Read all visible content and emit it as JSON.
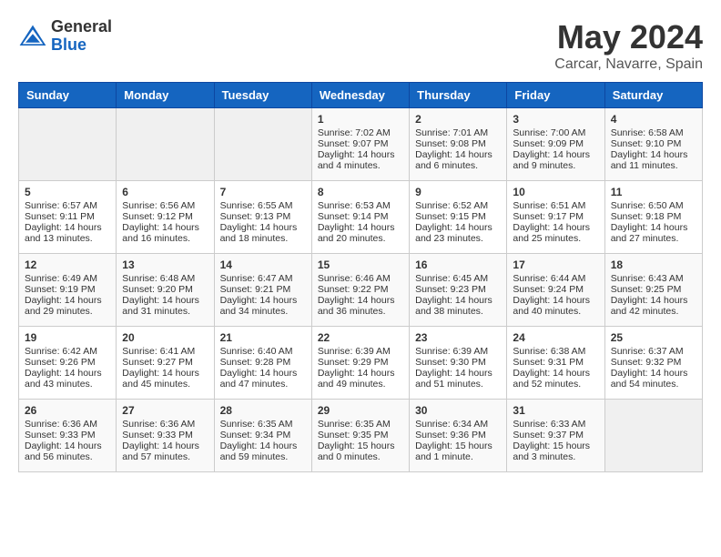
{
  "header": {
    "logo_general": "General",
    "logo_blue": "Blue",
    "month_year": "May 2024",
    "location": "Carcar, Navarre, Spain"
  },
  "calendar": {
    "days_of_week": [
      "Sunday",
      "Monday",
      "Tuesday",
      "Wednesday",
      "Thursday",
      "Friday",
      "Saturday"
    ],
    "weeks": [
      [
        {
          "day": "",
          "sunrise": "",
          "sunset": "",
          "daylight": ""
        },
        {
          "day": "",
          "sunrise": "",
          "sunset": "",
          "daylight": ""
        },
        {
          "day": "",
          "sunrise": "",
          "sunset": "",
          "daylight": ""
        },
        {
          "day": "1",
          "sunrise": "Sunrise: 7:02 AM",
          "sunset": "Sunset: 9:07 PM",
          "daylight": "Daylight: 14 hours and 4 minutes."
        },
        {
          "day": "2",
          "sunrise": "Sunrise: 7:01 AM",
          "sunset": "Sunset: 9:08 PM",
          "daylight": "Daylight: 14 hours and 6 minutes."
        },
        {
          "day": "3",
          "sunrise": "Sunrise: 7:00 AM",
          "sunset": "Sunset: 9:09 PM",
          "daylight": "Daylight: 14 hours and 9 minutes."
        },
        {
          "day": "4",
          "sunrise": "Sunrise: 6:58 AM",
          "sunset": "Sunset: 9:10 PM",
          "daylight": "Daylight: 14 hours and 11 minutes."
        }
      ],
      [
        {
          "day": "5",
          "sunrise": "Sunrise: 6:57 AM",
          "sunset": "Sunset: 9:11 PM",
          "daylight": "Daylight: 14 hours and 13 minutes."
        },
        {
          "day": "6",
          "sunrise": "Sunrise: 6:56 AM",
          "sunset": "Sunset: 9:12 PM",
          "daylight": "Daylight: 14 hours and 16 minutes."
        },
        {
          "day": "7",
          "sunrise": "Sunrise: 6:55 AM",
          "sunset": "Sunset: 9:13 PM",
          "daylight": "Daylight: 14 hours and 18 minutes."
        },
        {
          "day": "8",
          "sunrise": "Sunrise: 6:53 AM",
          "sunset": "Sunset: 9:14 PM",
          "daylight": "Daylight: 14 hours and 20 minutes."
        },
        {
          "day": "9",
          "sunrise": "Sunrise: 6:52 AM",
          "sunset": "Sunset: 9:15 PM",
          "daylight": "Daylight: 14 hours and 23 minutes."
        },
        {
          "day": "10",
          "sunrise": "Sunrise: 6:51 AM",
          "sunset": "Sunset: 9:17 PM",
          "daylight": "Daylight: 14 hours and 25 minutes."
        },
        {
          "day": "11",
          "sunrise": "Sunrise: 6:50 AM",
          "sunset": "Sunset: 9:18 PM",
          "daylight": "Daylight: 14 hours and 27 minutes."
        }
      ],
      [
        {
          "day": "12",
          "sunrise": "Sunrise: 6:49 AM",
          "sunset": "Sunset: 9:19 PM",
          "daylight": "Daylight: 14 hours and 29 minutes."
        },
        {
          "day": "13",
          "sunrise": "Sunrise: 6:48 AM",
          "sunset": "Sunset: 9:20 PM",
          "daylight": "Daylight: 14 hours and 31 minutes."
        },
        {
          "day": "14",
          "sunrise": "Sunrise: 6:47 AM",
          "sunset": "Sunset: 9:21 PM",
          "daylight": "Daylight: 14 hours and 34 minutes."
        },
        {
          "day": "15",
          "sunrise": "Sunrise: 6:46 AM",
          "sunset": "Sunset: 9:22 PM",
          "daylight": "Daylight: 14 hours and 36 minutes."
        },
        {
          "day": "16",
          "sunrise": "Sunrise: 6:45 AM",
          "sunset": "Sunset: 9:23 PM",
          "daylight": "Daylight: 14 hours and 38 minutes."
        },
        {
          "day": "17",
          "sunrise": "Sunrise: 6:44 AM",
          "sunset": "Sunset: 9:24 PM",
          "daylight": "Daylight: 14 hours and 40 minutes."
        },
        {
          "day": "18",
          "sunrise": "Sunrise: 6:43 AM",
          "sunset": "Sunset: 9:25 PM",
          "daylight": "Daylight: 14 hours and 42 minutes."
        }
      ],
      [
        {
          "day": "19",
          "sunrise": "Sunrise: 6:42 AM",
          "sunset": "Sunset: 9:26 PM",
          "daylight": "Daylight: 14 hours and 43 minutes."
        },
        {
          "day": "20",
          "sunrise": "Sunrise: 6:41 AM",
          "sunset": "Sunset: 9:27 PM",
          "daylight": "Daylight: 14 hours and 45 minutes."
        },
        {
          "day": "21",
          "sunrise": "Sunrise: 6:40 AM",
          "sunset": "Sunset: 9:28 PM",
          "daylight": "Daylight: 14 hours and 47 minutes."
        },
        {
          "day": "22",
          "sunrise": "Sunrise: 6:39 AM",
          "sunset": "Sunset: 9:29 PM",
          "daylight": "Daylight: 14 hours and 49 minutes."
        },
        {
          "day": "23",
          "sunrise": "Sunrise: 6:39 AM",
          "sunset": "Sunset: 9:30 PM",
          "daylight": "Daylight: 14 hours and 51 minutes."
        },
        {
          "day": "24",
          "sunrise": "Sunrise: 6:38 AM",
          "sunset": "Sunset: 9:31 PM",
          "daylight": "Daylight: 14 hours and 52 minutes."
        },
        {
          "day": "25",
          "sunrise": "Sunrise: 6:37 AM",
          "sunset": "Sunset: 9:32 PM",
          "daylight": "Daylight: 14 hours and 54 minutes."
        }
      ],
      [
        {
          "day": "26",
          "sunrise": "Sunrise: 6:36 AM",
          "sunset": "Sunset: 9:33 PM",
          "daylight": "Daylight: 14 hours and 56 minutes."
        },
        {
          "day": "27",
          "sunrise": "Sunrise: 6:36 AM",
          "sunset": "Sunset: 9:33 PM",
          "daylight": "Daylight: 14 hours and 57 minutes."
        },
        {
          "day": "28",
          "sunrise": "Sunrise: 6:35 AM",
          "sunset": "Sunset: 9:34 PM",
          "daylight": "Daylight: 14 hours and 59 minutes."
        },
        {
          "day": "29",
          "sunrise": "Sunrise: 6:35 AM",
          "sunset": "Sunset: 9:35 PM",
          "daylight": "Daylight: 15 hours and 0 minutes."
        },
        {
          "day": "30",
          "sunrise": "Sunrise: 6:34 AM",
          "sunset": "Sunset: 9:36 PM",
          "daylight": "Daylight: 15 hours and 1 minute."
        },
        {
          "day": "31",
          "sunrise": "Sunrise: 6:33 AM",
          "sunset": "Sunset: 9:37 PM",
          "daylight": "Daylight: 15 hours and 3 minutes."
        },
        {
          "day": "",
          "sunrise": "",
          "sunset": "",
          "daylight": ""
        }
      ]
    ]
  }
}
